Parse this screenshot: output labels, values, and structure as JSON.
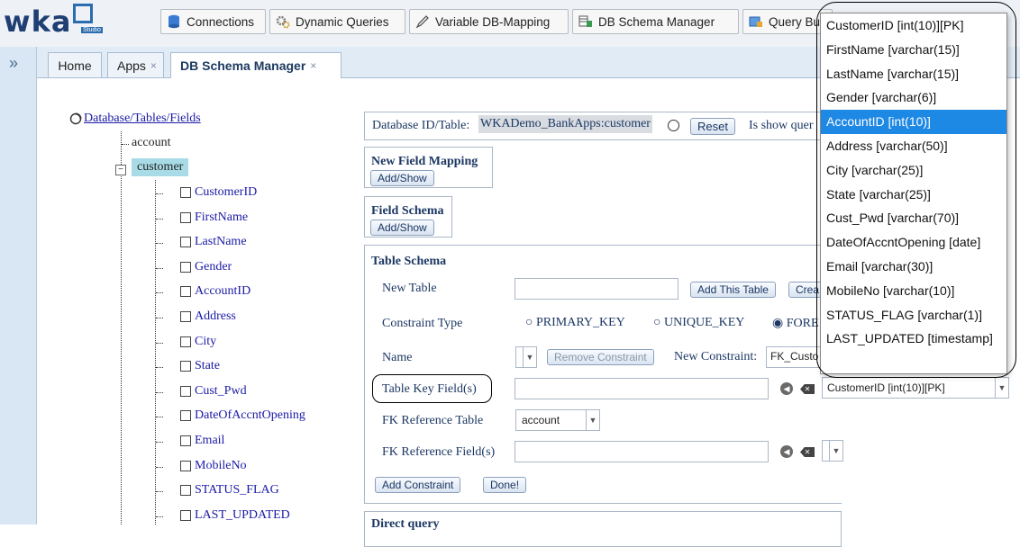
{
  "logo": {
    "text": "wka",
    "sub": "Studio"
  },
  "toolbar": {
    "connections": "Connections",
    "dynamic_queries": "Dynamic Queries",
    "variable_db_mapping": "Variable DB-Mapping",
    "db_schema_manager": "DB Schema Manager",
    "query_builder": "Query Bu"
  },
  "rail": {
    "expand": "»"
  },
  "tabs": {
    "home": "Home",
    "apps": "Apps",
    "db_schema": "DB Schema Manager",
    "close": "×"
  },
  "tree": {
    "root": "Database/Tables/Fields",
    "tables": [
      "account",
      "customer"
    ],
    "fields": [
      "CustomerID",
      "FirstName",
      "LastName",
      "Gender",
      "AccountID",
      "Address",
      "City",
      "State",
      "Cust_Pwd",
      "DateOfAccntOpening",
      "Email",
      "MobileNo",
      "STATUS_FLAG",
      "LAST_UPDATED"
    ]
  },
  "db": {
    "label": "Database ID/Table:",
    "value": "WKADemo_BankApps:customer",
    "reset": "Reset",
    "show_query": "Is show quer"
  },
  "new_field_mapping": {
    "title": "New Field Mapping",
    "button": "Add/Show"
  },
  "field_schema": {
    "title": "Field Schema",
    "button": "Add/Show"
  },
  "table_schema": {
    "title": "Table Schema",
    "new_table": "New Table",
    "add_table": "Add This Table",
    "create": "Crea",
    "constraint_type": "Constraint Type",
    "primary_key": "PRIMARY_KEY",
    "unique_key": "UNIQUE_KEY",
    "foreign": "FORE",
    "name": "Name",
    "remove_constraint": "Remove Constraint",
    "new_constraint": "New Constraint:",
    "new_constraint_value": "FK_Custo",
    "table_key_fields": "Table Key Field(s)",
    "key_field_select": "CustomerID [int(10)][PK]",
    "fk_ref_table": "FK Reference Table",
    "fk_ref_table_value": "account",
    "fk_ref_fields": "FK Reference Field(s)",
    "add_constraint": "Add Constraint",
    "done": "Done!",
    "next_section": "Direct query"
  },
  "dropdown": {
    "items": [
      "CustomerID [int(10)][PK]",
      "FirstName [varchar(15)]",
      "LastName [varchar(15)]",
      "Gender [varchar(6)]",
      "AccountID [int(10)]",
      "Address [varchar(50)]",
      "City [varchar(25)]",
      "State [varchar(25)]",
      "Cust_Pwd [varchar(70)]",
      "DateOfAccntOpening [date]",
      "Email [varchar(30)]",
      "MobileNo [varchar(10)]",
      "STATUS_FLAG [varchar(1)]",
      "LAST_UPDATED [timestamp]"
    ],
    "highlighted": "AccountID [int(10)]"
  }
}
